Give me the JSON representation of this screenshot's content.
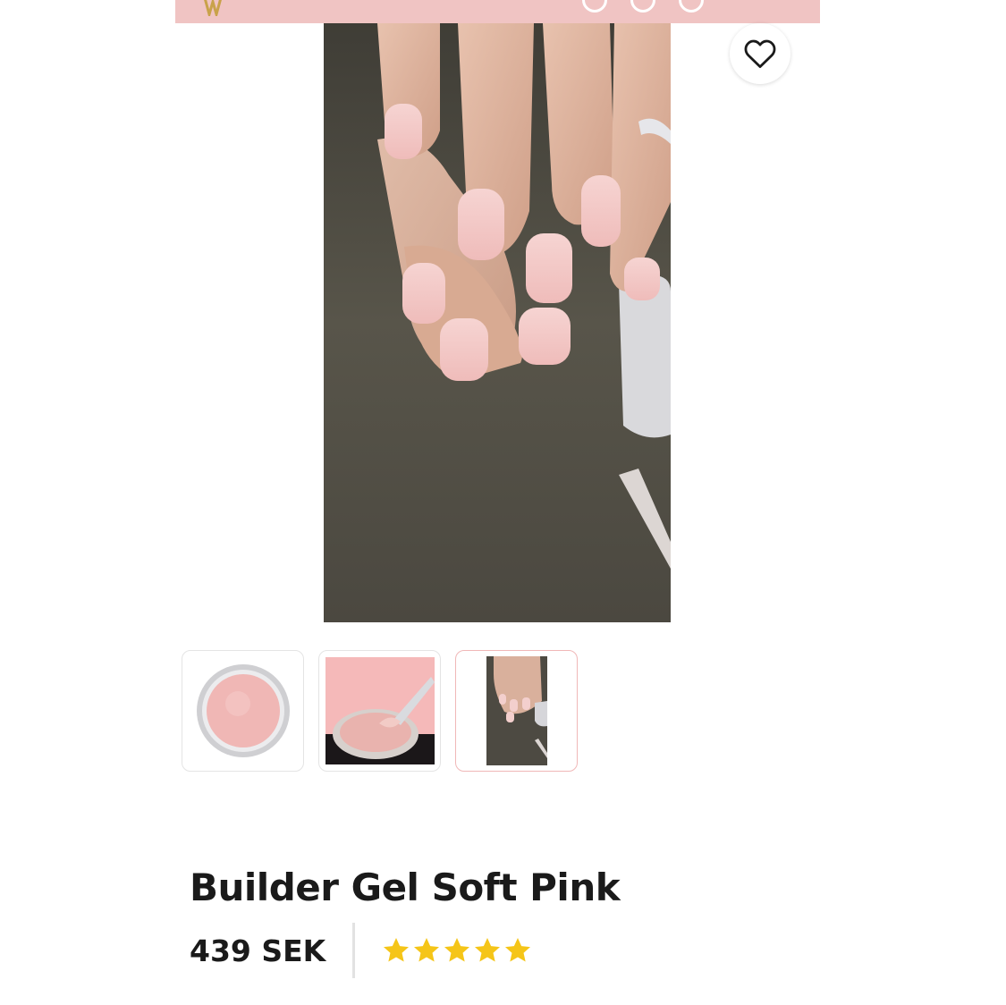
{
  "header": {
    "logo_icon": "brand-logo-icon",
    "icons": [
      "search-icon",
      "account-icon",
      "cart-icon"
    ]
  },
  "gallery": {
    "main_image": "hands-soft-pink-nails-image",
    "wishlist_icon": "heart-icon",
    "thumbnails": [
      {
        "name": "gel-jar-top-view",
        "active": false
      },
      {
        "name": "gel-jar-with-brush",
        "active": false
      },
      {
        "name": "hands-soft-pink-nails",
        "active": true
      }
    ]
  },
  "product": {
    "title": "Builder Gel Soft Pink",
    "price": "439 SEK",
    "rating": 5,
    "rating_max": 5
  },
  "colors": {
    "brand_pink": "#f0c4c3",
    "gel_pink": "#f0b7b5",
    "star_yellow": "#f5c518",
    "text": "#1a1a1a"
  }
}
